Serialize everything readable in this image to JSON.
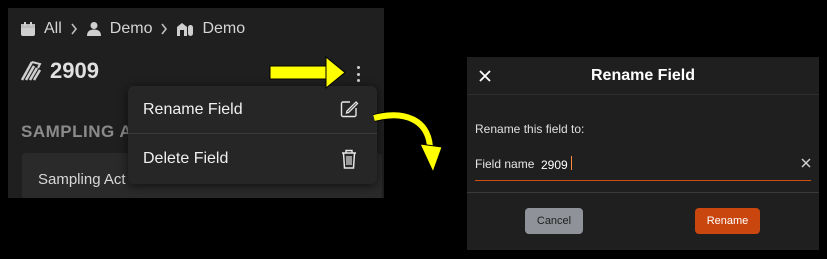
{
  "breadcrumb": {
    "items": [
      {
        "label": "All",
        "icon": "calendar-icon"
      },
      {
        "label": "Demo",
        "icon": "person-icon"
      },
      {
        "label": "Demo",
        "icon": "farm-icon"
      }
    ],
    "separator_icon": "chevron-right-icon"
  },
  "field": {
    "title": "2909",
    "icon": "field-icon",
    "menu_icon": "kebab-menu-icon"
  },
  "section": {
    "heading": "SAMPLING A",
    "card_text": "Sampling Act"
  },
  "context_menu": {
    "items": [
      {
        "label": "Rename Field",
        "icon": "edit-icon"
      },
      {
        "label": "Delete Field",
        "icon": "trash-icon"
      }
    ]
  },
  "annotations": {
    "arrow_color": "#ffff00"
  },
  "dialog": {
    "title": "Rename Field",
    "close_icon": "close-icon",
    "prompt": "Rename this field to:",
    "field_label": "Field name",
    "field_value": "2909",
    "clear_icon": "clear-icon",
    "cancel_label": "Cancel",
    "rename_label": "Rename",
    "accent_color": "#c9470f"
  }
}
